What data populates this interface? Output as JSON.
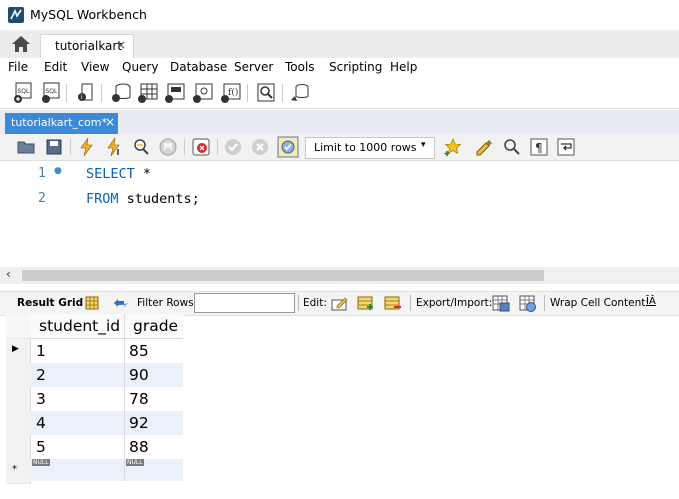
{
  "window": {
    "title": "MySQL Workbench"
  },
  "connection_tabs": [
    {
      "label": "tutorialkart",
      "close": "×"
    }
  ],
  "menu": [
    "File",
    "Edit",
    "View",
    "Query",
    "Database",
    "Server",
    "Tools",
    "Scripting",
    "Help"
  ],
  "main_toolbar": {
    "icons": [
      "new-sql-tab-icon",
      "open-sql-script-icon",
      "inspector-icon",
      "create-schema-icon",
      "create-table-icon",
      "create-view-icon",
      "create-procedure-icon",
      "create-function-icon",
      "search-table-data-icon",
      "reconnect-icon"
    ],
    "badge": "SQL"
  },
  "editor_tabs": [
    {
      "label": "tutorialkart_com*",
      "close": "×"
    }
  ],
  "sql_toolbar": {
    "icons": [
      "open-file-icon",
      "save-file-icon",
      "execute-icon",
      "execute-current-icon",
      "explain-icon",
      "stop-icon",
      "toggle-error-icon",
      "commit-icon",
      "rollback-icon",
      "autocommit-icon",
      "beautify-icon",
      "find-icon",
      "invisible-chars-icon",
      "wrap-lines-icon",
      "add-snippet-icon"
    ],
    "limit_select": {
      "value": "Limit to 1000 rows",
      "arrow": "▾"
    }
  },
  "editor": {
    "lines": [
      {
        "number": "1",
        "keyword": "SELECT",
        "rest": " *",
        "marker": "●"
      },
      {
        "number": "2",
        "keyword": "FROM",
        "rest": " students;"
      }
    ]
  },
  "scrollbar": {
    "left_arrow": "‹"
  },
  "result_toolbar": {
    "result_grid": "Result Grid",
    "filter_rows": "Filter Rows:",
    "filter_value": "",
    "edit": "Edit:",
    "export_import": "Export/Import:",
    "wrap_cell": "Wrap Cell Content:",
    "wrap_icon": "ĪĀ"
  },
  "grid": {
    "columns": [
      "student_id",
      "grade"
    ],
    "rows": [
      [
        "1",
        "85"
      ],
      [
        "2",
        "90"
      ],
      [
        "3",
        "78"
      ],
      [
        "4",
        "92"
      ],
      [
        "5",
        "88"
      ]
    ],
    "new_row_marker": "*",
    "null_label": "NULL",
    "current_row_marker": "▶"
  },
  "colors": {
    "accent": "#3b89d8",
    "keyword": "#0b5fb3",
    "alt_row": "#eaf1fb"
  }
}
